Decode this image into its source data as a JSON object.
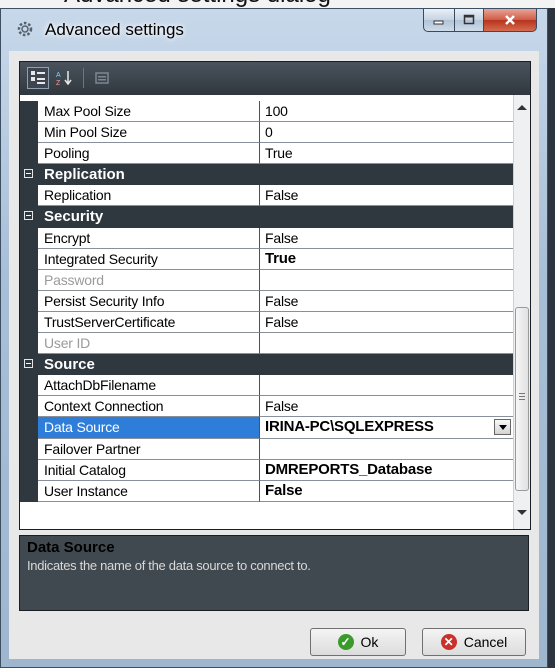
{
  "background_caption": "Advanced settings dialog",
  "window": {
    "title": "Advanced settings"
  },
  "toolbar": {
    "buttons": [
      {
        "icon": "categorized-view-icon",
        "active": true
      },
      {
        "icon": "alphabetical-sort-icon",
        "active": false
      },
      {
        "icon": "property-pages-icon",
        "active": false
      }
    ]
  },
  "grid": {
    "rows": [
      {
        "type": "property",
        "name": "Max Pool Size",
        "value": "100"
      },
      {
        "type": "property",
        "name": "Min Pool Size",
        "value": "0"
      },
      {
        "type": "property",
        "name": "Pooling",
        "value": "True"
      },
      {
        "type": "category",
        "name": "Replication"
      },
      {
        "type": "property",
        "name": "Replication",
        "value": "False"
      },
      {
        "type": "category",
        "name": "Security"
      },
      {
        "type": "property",
        "name": "Encrypt",
        "value": "False"
      },
      {
        "type": "property",
        "name": "Integrated Security",
        "value": "True",
        "bold": true
      },
      {
        "type": "property",
        "name": "Password",
        "value": "",
        "disabled": true
      },
      {
        "type": "property",
        "name": "Persist Security Info",
        "value": "False"
      },
      {
        "type": "property",
        "name": "TrustServerCertificate",
        "value": "False"
      },
      {
        "type": "property",
        "name": "User ID",
        "value": "",
        "disabled": true
      },
      {
        "type": "category",
        "name": "Source"
      },
      {
        "type": "property",
        "name": "AttachDbFilename",
        "value": ""
      },
      {
        "type": "property",
        "name": "Context Connection",
        "value": "False"
      },
      {
        "type": "property",
        "name": "Data Source",
        "value": "IRINA-PC\\SQLEXPRESS",
        "bold": true,
        "selected": true,
        "dropdown": true
      },
      {
        "type": "property",
        "name": "Failover Partner",
        "value": ""
      },
      {
        "type": "property",
        "name": "Initial Catalog",
        "value": "DMREPORTS_Database",
        "bold": true
      },
      {
        "type": "property",
        "name": "User Instance",
        "value": "False",
        "bold": true
      }
    ]
  },
  "help": {
    "title": "Data Source",
    "description": "Indicates the name of the data source to connect to."
  },
  "buttons": {
    "ok_label": "Ok",
    "cancel_label": "Cancel"
  },
  "colors": {
    "accent_selected": "#2e7dd8",
    "category_bg": "#2f373f",
    "ok_icon": "#3a9a2a",
    "cancel_icon": "#c8322a"
  }
}
